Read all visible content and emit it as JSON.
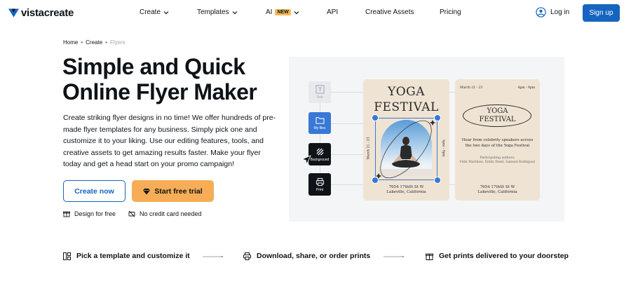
{
  "nav": {
    "logo": "vistacreate",
    "items": [
      {
        "label": "Create",
        "has_menu": true
      },
      {
        "label": "Templates",
        "has_menu": true
      },
      {
        "label": "AI",
        "badge": "NEW",
        "has_menu": true
      },
      {
        "label": "API"
      },
      {
        "label": "Creative Assets"
      },
      {
        "label": "Pricing"
      }
    ],
    "login": "Log in",
    "signup": "Sign up"
  },
  "breadcrumb": [
    "Home",
    "Create",
    "Flyers"
  ],
  "hero": {
    "title": "Simple and Quick Online Flyer Maker",
    "description": "Create striking flyer designs in no time! We offer hundreds of pre-made flyer templates for any business. Simply pick one and customize it to your liking. Use our editing features, tools, and creative assets to get amazing results faster. Make your flyer today and get a head start on your promo campaign!",
    "cta_primary": "Create now",
    "cta_secondary": "Start free trial",
    "perks": [
      "Design for free",
      "No credit card needed"
    ]
  },
  "preview": {
    "tools": [
      "Text",
      "My files",
      "Background",
      "Print"
    ],
    "poster1": {
      "title_line1": "YOGA",
      "title_line2": "FESTIVAL",
      "side_left": "March 21 - 23",
      "side_right": "4pm - 9pm",
      "address_line1": "7654 17thSt St W",
      "address_line2": "Lakeville, California"
    },
    "poster2": {
      "date": "March 21 - 23",
      "time": "4pm - 9pm",
      "title_line1": "YOGA",
      "title_line2": "FESTIVAL",
      "body": "Hear from celebrity speakers across the two days of the Yoga Festival",
      "authors_heading": "Participating authors:",
      "authors": "Felix Martinez, Emily Stent, Samuel Rodriguez",
      "address_line1": "7654 17thSt St W",
      "address_line2": "Lakeville, California"
    }
  },
  "steps": [
    "Pick a template and customize it",
    "Download, share, or order prints",
    "Get prints delivered to your doorstep"
  ],
  "colors": {
    "brand_blue": "#1565c0",
    "accent_orange": "#f6ad55",
    "badge_yellow": "#f7b955",
    "text_dark": "#0e1318",
    "poster_bg": "#efe3d3"
  }
}
